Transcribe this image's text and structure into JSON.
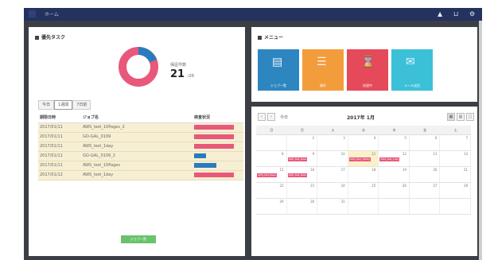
{
  "topbar": {
    "home_label": "ホーム",
    "icons": [
      "bell-icon",
      "bookmark-icon",
      "gear-icon"
    ]
  },
  "tasks_panel": {
    "title": "優先タスク",
    "donut": {
      "value_label": "保証件数",
      "count": "21",
      "total": "/26",
      "filled_fraction": 0.19,
      "colors": {
        "primary": "#e8587a",
        "secondary": "#2a7bbd"
      }
    },
    "tabs": [
      "今日",
      "1週間",
      "7日前"
    ],
    "headers": {
      "date": "期限日時",
      "title": "ジョブ名",
      "status": "検査状況"
    },
    "rows": [
      {
        "date": "2017/01/11",
        "title": "AWS_test_10Pages_2",
        "status": "",
        "bar": "pink",
        "progress": 1.0
      },
      {
        "date": "2017/01/11",
        "title": "GO-GAL_0109",
        "status": "",
        "bar": "pink",
        "progress": 1.0
      },
      {
        "date": "2017/01/11",
        "title": "AWS_test_1day",
        "status": "",
        "bar": "pink",
        "progress": 1.0
      },
      {
        "date": "2017/01/11",
        "title": "GO-GAL_0109_2",
        "status": "",
        "bar": "blue",
        "progress": 0.3
      },
      {
        "date": "2017/01/11",
        "title": "AWS_test_10Pages",
        "status": "",
        "bar": "blue",
        "progress": 0.55
      },
      {
        "date": "2017/01/12",
        "title": "AWS_test_1day",
        "status": "",
        "bar": "pink",
        "progress": 1.0
      }
    ],
    "button_label": "ジョブ一覧"
  },
  "menu_panel": {
    "title": "メニュー",
    "tiles": [
      {
        "label": "ジョブ一覧",
        "color": "#2e86c1",
        "icon": "document-icon"
      },
      {
        "label": "操作",
        "color": "#f39c3c",
        "icon": "list-icon"
      },
      {
        "label": "処理中",
        "color": "#e44a5a",
        "icon": "hourglass-icon"
      },
      {
        "label": "メール送信",
        "color": "#3cc0d8",
        "icon": "mail-icon"
      }
    ]
  },
  "calendar": {
    "title": "2017年 1月",
    "today_label": "今日",
    "weekdays": [
      "日",
      "月",
      "火",
      "水",
      "木",
      "金",
      "土"
    ],
    "weeks": [
      [
        "",
        "2",
        "3",
        "4",
        "5",
        "6",
        "7"
      ],
      [
        "8",
        "9",
        "10",
        "11",
        "12",
        "13",
        "14"
      ],
      [
        "15",
        "16",
        "17",
        "18",
        "19",
        "20",
        "21"
      ],
      [
        "22",
        "23",
        "24",
        "25",
        "26",
        "27",
        "28"
      ],
      [
        "29",
        "30",
        "31",
        "",
        "",
        "",
        ""
      ]
    ],
    "events": [
      {
        "week": 1,
        "day": 1,
        "label": "AWS_test_Base"
      },
      {
        "week": 1,
        "day": 3,
        "label": "AWS_test_10Pag"
      },
      {
        "week": 1,
        "day": 4,
        "label": "AWS_test_1day"
      },
      {
        "week": 2,
        "day": 0,
        "label": "AWS_test_Base"
      },
      {
        "week": 2,
        "day": 1,
        "label": "AWS_test_Base"
      }
    ]
  }
}
